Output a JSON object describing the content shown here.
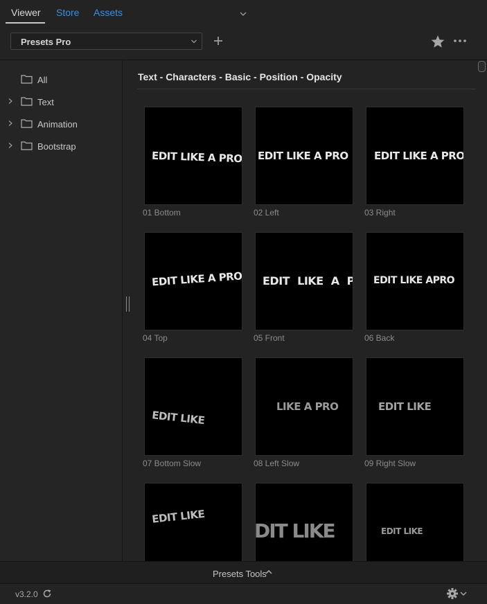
{
  "tabs": [
    {
      "label": "Viewer",
      "active": true
    },
    {
      "label": "Store",
      "active": false
    },
    {
      "label": "Assets",
      "active": false
    }
  ],
  "toolbar": {
    "preset_select": "Presets Pro",
    "icons": [
      "chevron-down-icon",
      "plus-icon",
      "star-icon",
      "more-icon"
    ]
  },
  "sidebar": {
    "items": [
      {
        "label": "All",
        "expandable": false
      },
      {
        "label": "Text",
        "expandable": true
      },
      {
        "label": "Animation",
        "expandable": true
      },
      {
        "label": "Bootstrap",
        "expandable": true
      }
    ]
  },
  "content": {
    "breadcrumb": "Text - Characters - Basic - Position - Opacity",
    "presets": [
      {
        "caption": "01 Bottom",
        "preview": "EDIT LIKE A PRO"
      },
      {
        "caption": "02 Left",
        "preview": "EDIT LIKE A PRO"
      },
      {
        "caption": "03 Right",
        "preview": "EDIT LIKE A PRO"
      },
      {
        "caption": "04 Top",
        "preview": "EDIT LIKE A PRO"
      },
      {
        "caption": "05 Front",
        "preview": "EDIT LIKE A P"
      },
      {
        "caption": "06 Back",
        "preview": "EDIT LIKE APRO"
      },
      {
        "caption": "07 Bottom Slow",
        "preview": "EDIT LIKE"
      },
      {
        "caption": "08 Left Slow",
        "preview": "LIKE A PRO"
      },
      {
        "caption": "09 Right Slow",
        "preview": "EDIT LIKE"
      },
      {
        "caption": "",
        "preview": "EDIT LIKE"
      },
      {
        "caption": "",
        "preview": "DIT LIKE"
      },
      {
        "caption": "",
        "preview": "EDIT LIKE"
      }
    ]
  },
  "bottom": {
    "tools_label": "Presets Tools",
    "version": "v3.2.0"
  },
  "colors": {
    "background": "#232323",
    "accent_link": "#3c8fe0",
    "thumbnail_bg": "#000000"
  }
}
